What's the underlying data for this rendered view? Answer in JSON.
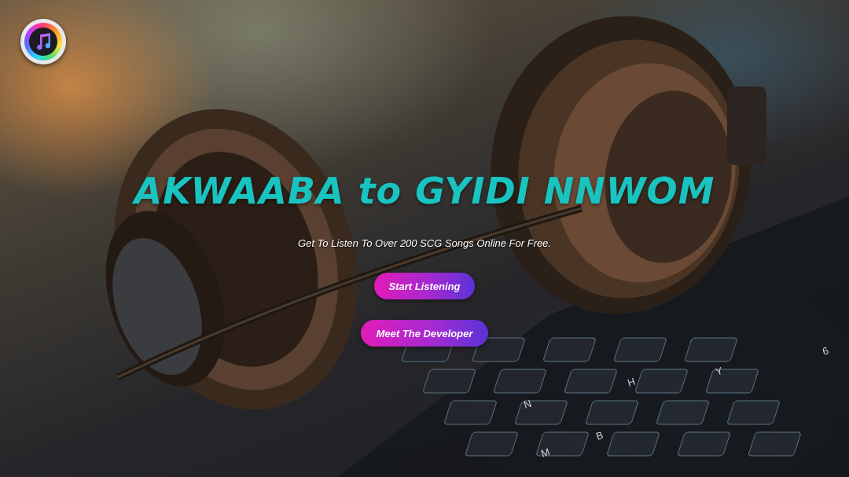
{
  "app": {
    "logo_icon": "music-note-icon"
  },
  "hero": {
    "title": "AKWAABA to GYIDI NNWOM",
    "subtitle": "Get To Listen To Over 200 SCG Songs Online For Free."
  },
  "buttons": {
    "start_listening": "Start Listening",
    "meet_developer": "Meet The Developer"
  },
  "keyboard_keys": [
    "N",
    "M",
    "H",
    "B",
    "Y",
    "6"
  ],
  "colors": {
    "title": "#19c3c0",
    "button_gradient_start": "#e21bb8",
    "button_gradient_end": "#5a33d8",
    "subtitle": "#ffffff"
  }
}
